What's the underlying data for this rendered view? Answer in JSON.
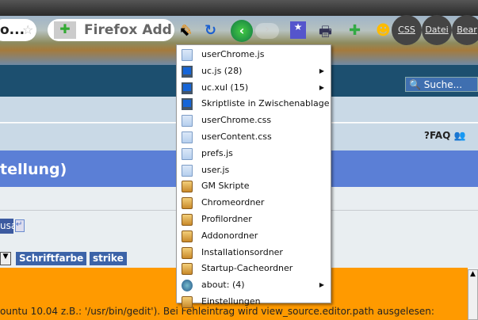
{
  "toolbar": {
    "url_fragment": "o...",
    "search_text": "Firefox Add",
    "buttons": [
      "CSS",
      "Datei",
      "Bear"
    ]
  },
  "nav": {
    "search_placeholder": "Suche..."
  },
  "links": {
    "faq": "FAQ"
  },
  "page": {
    "title_fragment": "tellung)",
    "input_fragment": "usa",
    "format_buttons": [
      "Schriftfarbe",
      "strike"
    ],
    "body_text": "ountu 10.04 z.B.: '/usr/bin/gedit'). Bei Fehleintrag wird view_source.editor.path ausgelesen:"
  },
  "menu": {
    "items": [
      {
        "label": "userChrome.js",
        "icon": "file"
      },
      {
        "label": "uc.js (28)",
        "icon": "screen",
        "submenu": true
      },
      {
        "label": "uc.xul (15)",
        "icon": "screen",
        "submenu": true
      },
      {
        "label": "Skriptliste in Zwischenablage",
        "icon": "screen"
      },
      {
        "label": "userChrome.css",
        "icon": "file"
      },
      {
        "label": "userContent.css",
        "icon": "file"
      },
      {
        "label": "prefs.js",
        "icon": "file"
      },
      {
        "label": "user.js",
        "icon": "file"
      },
      {
        "label": "GM Skripte",
        "icon": "folder"
      },
      {
        "label": "Chromeordner",
        "icon": "folder"
      },
      {
        "label": "Profilordner",
        "icon": "folder"
      },
      {
        "label": "Addonordner",
        "icon": "folder"
      },
      {
        "label": "Installationsordner",
        "icon": "folder"
      },
      {
        "label": "Startup-Cacheordner",
        "icon": "folder"
      },
      {
        "label": "about: (4)",
        "icon": "globe",
        "submenu": true
      },
      {
        "label": "Einstellungen",
        "icon": "folder"
      }
    ]
  }
}
